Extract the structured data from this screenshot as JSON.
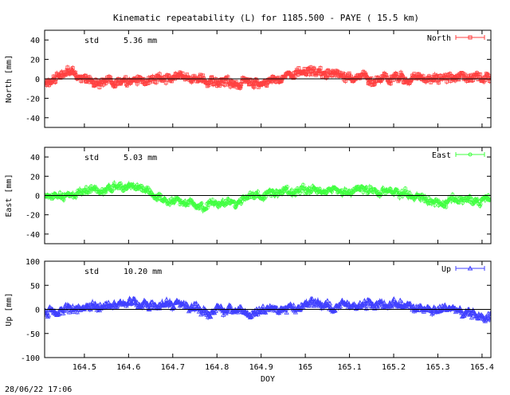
{
  "title": "Kinematic repeatability (L) for 1185.500 - PAYE  ( 15.5 km)",
  "timestamp": "28/06/22 17:06",
  "chart_data": [
    {
      "type": "scatter",
      "series": [
        {
          "name": "North",
          "color": "#ff4040",
          "marker": "square-errorbar"
        }
      ],
      "std_label": "std",
      "std_value": "5.36 mm",
      "ylabel": "North [mm]",
      "ylim": [
        -50,
        50
      ],
      "yticks": [
        -40,
        -20,
        0,
        20,
        40
      ],
      "xlim": [
        164.41,
        165.42
      ],
      "noise_amp": 4.5,
      "trend": [
        [
          164.41,
          -3
        ],
        [
          164.47,
          6
        ],
        [
          164.52,
          -2
        ],
        [
          164.6,
          -5
        ],
        [
          164.7,
          3
        ],
        [
          164.8,
          -2
        ],
        [
          164.9,
          -5
        ],
        [
          165.0,
          10
        ],
        [
          165.05,
          5
        ],
        [
          165.2,
          0
        ],
        [
          165.3,
          1
        ],
        [
          165.42,
          2
        ]
      ]
    },
    {
      "type": "scatter",
      "series": [
        {
          "name": "East",
          "color": "#40ff40",
          "marker": "circle-errorbar"
        }
      ],
      "std_label": "std",
      "std_value": "5.03 mm",
      "ylabel": "East [mm]",
      "ylim": [
        -50,
        50
      ],
      "yticks": [
        -40,
        -20,
        0,
        20,
        40
      ],
      "xlim": [
        164.41,
        165.42
      ],
      "noise_amp": 4.0,
      "trend": [
        [
          164.41,
          0
        ],
        [
          164.5,
          3
        ],
        [
          164.58,
          8
        ],
        [
          164.64,
          5
        ],
        [
          164.7,
          -6
        ],
        [
          164.78,
          -10
        ],
        [
          164.9,
          0
        ],
        [
          165.0,
          6
        ],
        [
          165.1,
          5
        ],
        [
          165.2,
          2
        ],
        [
          165.3,
          -7
        ],
        [
          165.42,
          -4
        ]
      ]
    },
    {
      "type": "scatter",
      "series": [
        {
          "name": "Up",
          "color": "#4040ff",
          "marker": "triangle-errorbar"
        }
      ],
      "std_label": "std",
      "std_value": "10.20 mm",
      "ylabel": "Up [mm]",
      "ylim": [
        -100,
        100
      ],
      "yticks": [
        -100,
        -50,
        0,
        50,
        100
      ],
      "xlim": [
        164.41,
        165.42
      ],
      "xlabel": "DOY",
      "xticks": [
        164.5,
        164.6,
        164.7,
        164.8,
        164.9,
        165,
        165.1,
        165.2,
        165.3,
        165.4
      ],
      "xtick_labels": [
        "164.5",
        "164.6",
        "164.7",
        "164.8",
        "164.9",
        "165",
        "165.1",
        "165.2",
        "165.3",
        "165.4"
      ],
      "noise_amp": 9.0,
      "trend": [
        [
          164.41,
          -5
        ],
        [
          164.5,
          5
        ],
        [
          164.6,
          12
        ],
        [
          164.7,
          5
        ],
        [
          164.8,
          0
        ],
        [
          164.9,
          -5
        ],
        [
          165.0,
          5
        ],
        [
          165.1,
          8
        ],
        [
          165.2,
          10
        ],
        [
          165.3,
          -5
        ],
        [
          165.42,
          -12
        ]
      ]
    }
  ]
}
